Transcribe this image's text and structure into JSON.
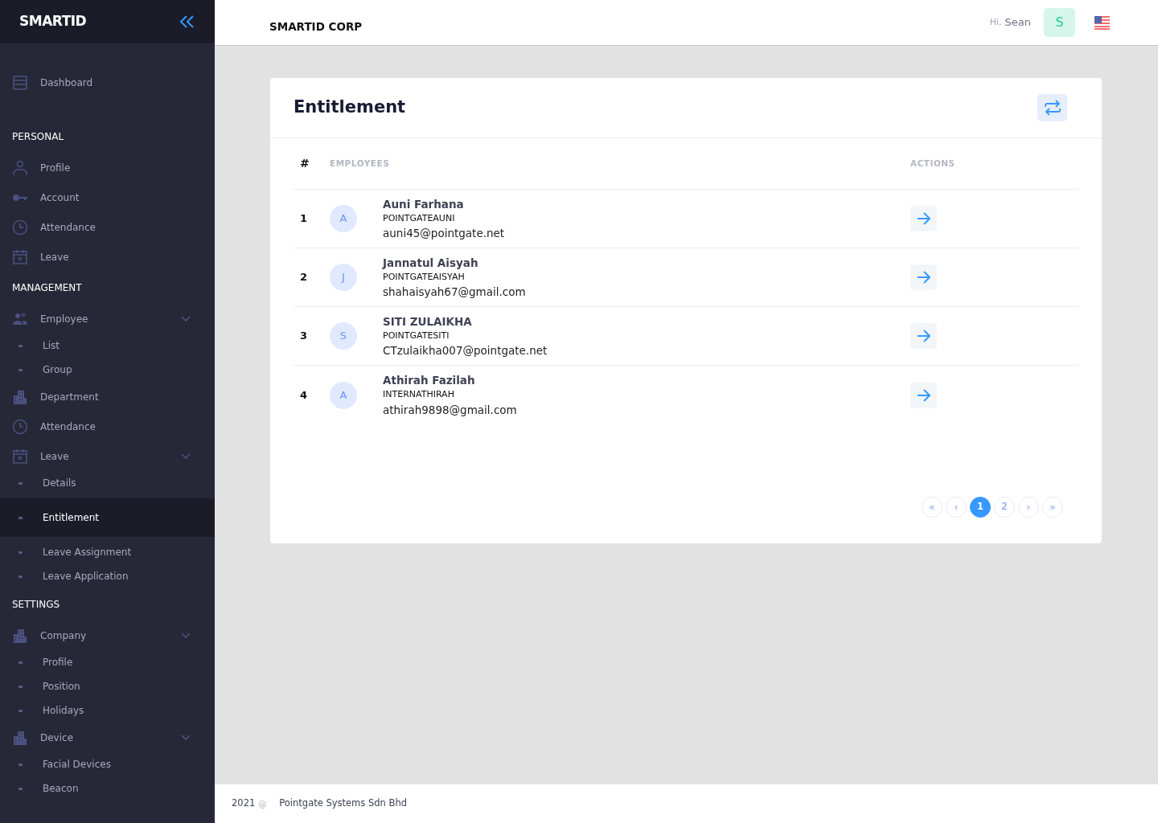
{
  "sidebar": {
    "logo": "SMARTID",
    "items": [
      {
        "kind": "item",
        "label": "Dashboard",
        "selected": false
      },
      {
        "kind": "heading",
        "label": "PERSONAL"
      },
      {
        "kind": "item",
        "label": "Profile",
        "selected": false
      },
      {
        "kind": "item",
        "label": "Account",
        "selected": false
      },
      {
        "kind": "item",
        "label": "Attendance",
        "selected": false
      },
      {
        "kind": "item",
        "label": "Leave",
        "selected": false
      },
      {
        "kind": "heading",
        "label": "MANAGEMENT"
      },
      {
        "kind": "group",
        "label": "Employee",
        "selected": false
      },
      {
        "kind": "sub",
        "label": "List",
        "selected": false
      },
      {
        "kind": "sub",
        "label": "Group",
        "selected": false
      },
      {
        "kind": "item",
        "label": "Department",
        "selected": false
      },
      {
        "kind": "item",
        "label": "Attendance",
        "selected": false
      },
      {
        "kind": "group",
        "label": "Leave",
        "selected": false
      },
      {
        "kind": "sub",
        "label": "Details",
        "selected": false
      },
      {
        "kind": "sub",
        "label": "Entitlement",
        "selected": true
      },
      {
        "kind": "sub",
        "label": "Leave Assignment",
        "selected": false
      },
      {
        "kind": "sub",
        "label": "Leave Application",
        "selected": false
      },
      {
        "kind": "heading",
        "label": "SETTINGS"
      },
      {
        "kind": "group",
        "label": "Company",
        "selected": false
      },
      {
        "kind": "sub",
        "label": "Profile",
        "selected": false
      },
      {
        "kind": "sub",
        "label": "Position",
        "selected": false
      },
      {
        "kind": "sub",
        "label": "Holidays",
        "selected": false
      },
      {
        "kind": "group",
        "label": "Device",
        "selected": false
      },
      {
        "kind": "sub",
        "label": "Facial Devices",
        "selected": false
      },
      {
        "kind": "sub",
        "label": "Beacon",
        "selected": false
      }
    ]
  },
  "header": {
    "company": "SMARTID CORP",
    "greeting": "Hi,",
    "user": "Sean",
    "avatar": "S"
  },
  "card": {
    "title": "Entitlement",
    "table": {
      "columns": [
        "#",
        "EMPLOYEES",
        "ACTIONS"
      ],
      "rows": [
        {
          "number": "1",
          "avatar": "A",
          "name": "Auni Farhana",
          "code": "POINTGATEAUNI",
          "email": "auni45@pointgate.net"
        },
        {
          "number": "2",
          "avatar": "J",
          "name": "Jannatul Aisyah",
          "code": "POINTGATEAISYAH",
          "email": "shahaisyah67@gmail.com"
        },
        {
          "number": "3",
          "avatar": "S",
          "name": "SITI ZULAIKHA",
          "code": "POINTGATESITI",
          "email": "CTzulaikha007@pointgate.net"
        },
        {
          "number": "4",
          "avatar": "A",
          "name": "Athirah Fazilah",
          "code": "INTERNATHIRAH",
          "email": "athirah9898@gmail.com"
        }
      ]
    },
    "pagination": [
      {
        "kind": "nav",
        "label": "«",
        "selected": false
      },
      {
        "kind": "nav",
        "label": "‹",
        "selected": false
      },
      {
        "kind": "page",
        "label": "1",
        "selected": true
      },
      {
        "kind": "page",
        "label": "2",
        "selected": false
      },
      {
        "kind": "nav",
        "label": "›",
        "selected": false
      },
      {
        "kind": "nav",
        "label": "»",
        "selected": false
      }
    ]
  },
  "footer": {
    "year": "2021",
    "symbol": "@",
    "company": "Pointgate Systems Sdn Bhd"
  }
}
